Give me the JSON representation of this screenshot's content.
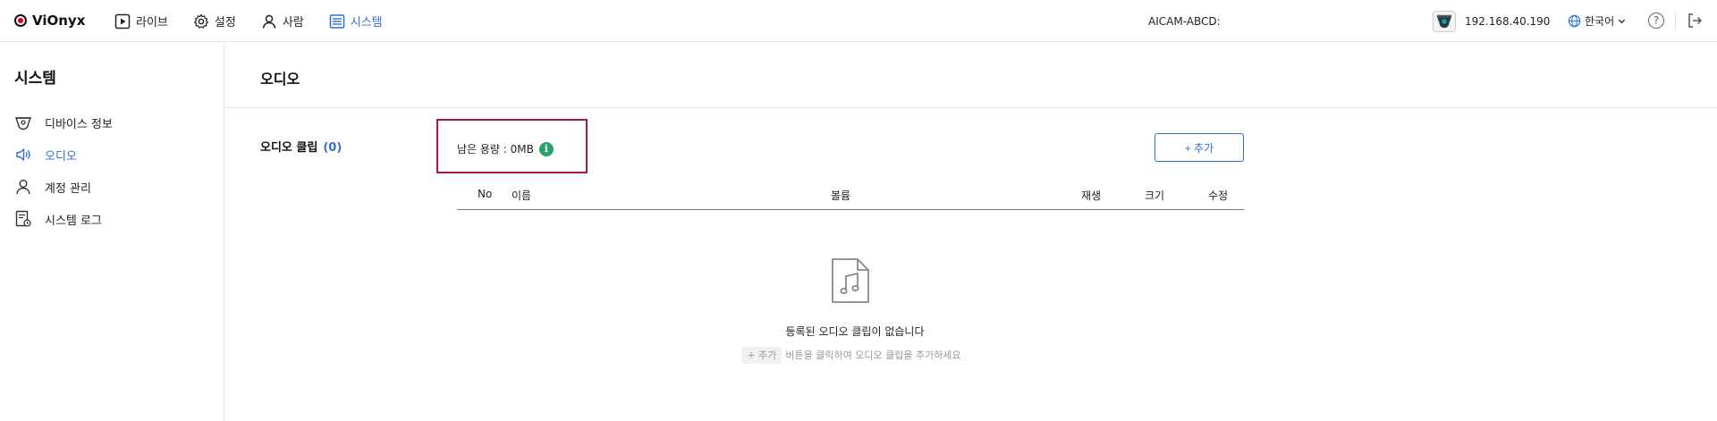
{
  "app": {
    "name": "ViOnyx"
  },
  "nav": {
    "items": [
      {
        "label": "라이브",
        "icon": "play-icon"
      },
      {
        "label": "설정",
        "icon": "gear-icon"
      },
      {
        "label": "사람",
        "icon": "person-icon"
      },
      {
        "label": "시스템",
        "icon": "system-icon",
        "active": true
      }
    ]
  },
  "header": {
    "device_label": "AICAM-ABCD:",
    "device_ip": "192.168.40.190",
    "language": "한국어",
    "help": "?"
  },
  "sidebar": {
    "title": "시스템",
    "items": [
      {
        "label": "디바이스 정보",
        "icon": "camera-icon"
      },
      {
        "label": "오디오",
        "icon": "speaker-icon",
        "active": true
      },
      {
        "label": "계정 관리",
        "icon": "person-icon"
      },
      {
        "label": "시스템 로그",
        "icon": "log-icon"
      }
    ]
  },
  "main": {
    "title": "오디오",
    "clip_label": "오디오 클립",
    "clip_count": "(0)",
    "capacity": "남은 용량 : 0MB",
    "add_label": "+ 추가",
    "columns": [
      "No",
      "이름",
      "볼륨",
      "재생",
      "크기",
      "수정"
    ],
    "empty": {
      "title": "등록된 오디오 클립이 없습니다",
      "hint_chip": "+ 추가",
      "hint_text": "버튼을 클릭하여 오디오 클립을 추가하세요"
    }
  },
  "colors": {
    "accent": "#2f6fd6",
    "highlight": "#a4193a",
    "info": "#27a46b"
  }
}
